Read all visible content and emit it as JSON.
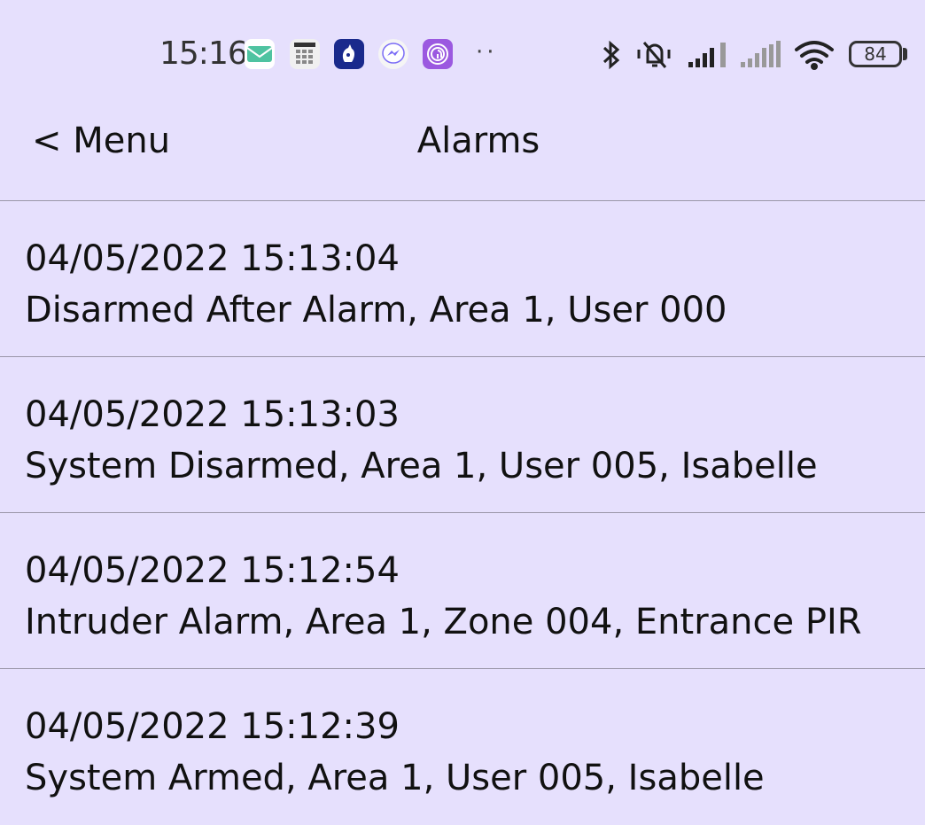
{
  "status_bar": {
    "time": "15:16",
    "battery": "84",
    "icons": [
      "mail-icon",
      "texecom-icon",
      "lottery-icon",
      "messenger-icon",
      "fingerprint-icon",
      "bluetooth-icon",
      "silent-icon",
      "signal-icon",
      "wifi-icon",
      "battery-icon"
    ],
    "more": "··"
  },
  "nav": {
    "back_label": "< Menu",
    "title": "Alarms"
  },
  "alarms": [
    {
      "timestamp": "04/05/2022 15:13:04",
      "description": "Disarmed After Alarm, Area 1, User 000"
    },
    {
      "timestamp": "04/05/2022 15:13:03",
      "description": "System Disarmed, Area 1, User 005, Isabelle"
    },
    {
      "timestamp": "04/05/2022 15:12:54",
      "description": "Intruder Alarm, Area 1, Zone 004, Entrance PIR"
    },
    {
      "timestamp": "04/05/2022 15:12:39",
      "description": "System Armed, Area 1, User 005, Isabelle"
    }
  ],
  "colors": {
    "background": "#e6e0fd",
    "divider": "#9a96a8",
    "text": "#111111"
  }
}
